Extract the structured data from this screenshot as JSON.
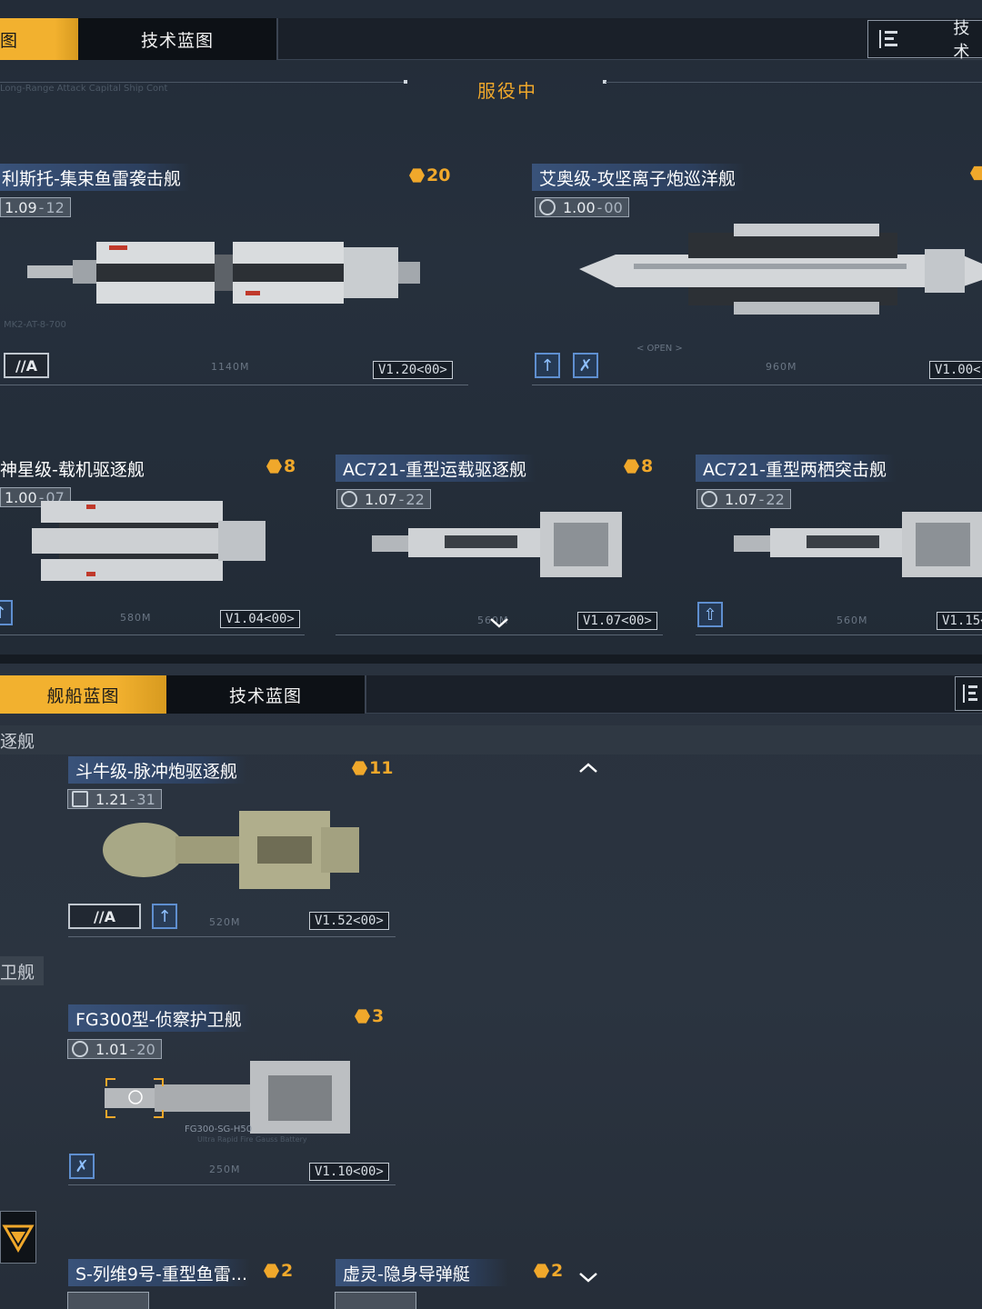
{
  "top": {
    "tabs": [
      {
        "label": "图",
        "active": true
      },
      {
        "label": "技术蓝图",
        "active": false
      }
    ],
    "right_tab": "技术",
    "section_title": "服役中",
    "faint_label": "Long-Range Attack Capital Ship Cont",
    "cards": [
      {
        "title": "利斯托-集束鱼雷袭击舰",
        "cost": "20",
        "version": "1.09",
        "version_sub": "12",
        "length": "1140M",
        "tag": "V1.20<00>",
        "badge": "//A",
        "spec": "MK2-AT-8-700"
      },
      {
        "title": "艾奥级-攻坚离子炮巡洋舰",
        "cost": "",
        "version": "1.00",
        "version_sub": "00",
        "length": "960M",
        "tag": "V1.00<",
        "open": "< OPEN >"
      },
      {
        "title": "神星级-载机驱逐舰",
        "cost": "8",
        "version": "1.00",
        "version_sub": "07",
        "length": "580M",
        "tag": "V1.04<00>"
      },
      {
        "title": "AC721-重型运载驱逐舰",
        "cost": "8",
        "version": "1.07",
        "version_sub": "22",
        "length": "560M",
        "tag": "V1.07<00>"
      },
      {
        "title": "AC721-重型两栖突击舰",
        "cost": "",
        "version": "1.07",
        "version_sub": "22",
        "length": "560M",
        "tag": "V1.15<"
      }
    ]
  },
  "bottom": {
    "tabs": [
      {
        "label": "舰船蓝图",
        "active": true
      },
      {
        "label": "技术蓝图",
        "active": false
      }
    ],
    "categories": [
      "逐舰",
      "卫舰"
    ],
    "cards": [
      {
        "title": "斗牛级-脉冲炮驱逐舰",
        "cost": "11",
        "version": "1.21",
        "version_sub": "31",
        "length": "520M",
        "tag": "V1.52<00>",
        "badge": "//A"
      },
      {
        "title": "FG300型-侦察护卫舰",
        "cost": "3",
        "version": "1.01",
        "version_sub": "20",
        "length": "250M",
        "tag": "V1.10<00>",
        "callout": "FG300-SG-H50",
        "callout_sub": "Ultra Rapid Fire Gauss Battery"
      },
      {
        "title": "S-列维9号-重型鱼雷...",
        "cost": "2"
      },
      {
        "title": "虚灵-隐身导弹艇",
        "cost": "2"
      }
    ]
  },
  "colors": {
    "accent": "#f2b12f",
    "title_bg": "#3a547d",
    "cost": "#f0a82b"
  }
}
